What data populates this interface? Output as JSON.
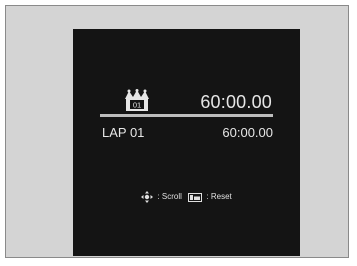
{
  "best": {
    "badge_text": "01",
    "time": "60:00.00"
  },
  "lap": {
    "label": "LAP 01",
    "time": "60:00.00"
  },
  "hints": {
    "scroll_label": ": Scroll",
    "reset_label": ": Reset"
  },
  "icons": {
    "crown": "crown-icon",
    "scroll": "dpad-icon",
    "reset": "menu-button-icon"
  },
  "colors": {
    "screen_background": "#141414",
    "text": "#e6e6e6",
    "divider": "#bdbdbd",
    "frame_background": "#d4d4d4"
  }
}
